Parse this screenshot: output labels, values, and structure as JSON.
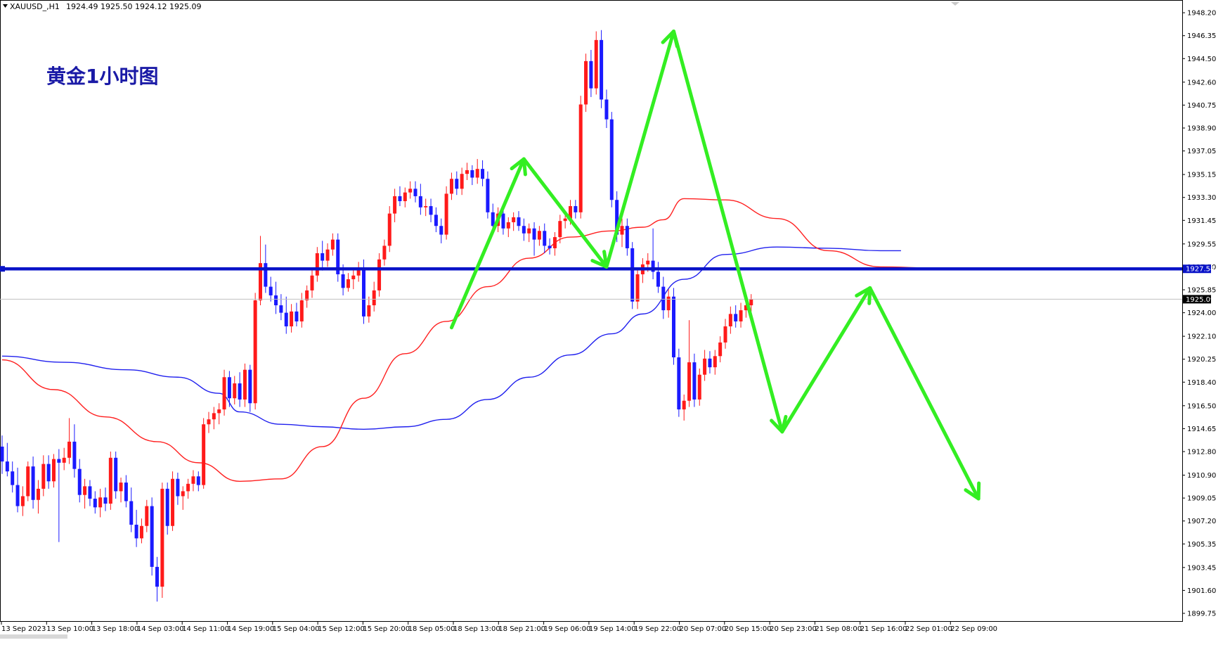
{
  "header": {
    "symbol": "XAUUSD_,H1",
    "ohlc": "1924.49 1925.50 1924.12 1925.09"
  },
  "title": "黄金1小时图",
  "colors": {
    "bull": "#ff1a1a",
    "bear": "#1a1aff",
    "ma_fast": "#ff2020",
    "ma_slow": "#2020ee",
    "level": "#0a14c8",
    "arrow": "#33ee22",
    "badge_level": "#0a14c8",
    "badge_price": "#000000"
  },
  "chart_data": {
    "type": "candlestick",
    "symbol": "XAUUSD_",
    "timeframe": "H1",
    "ylim": [
      1899.75,
      1949.0
    ],
    "y_ticks": [
      "1948.20",
      "1946.35",
      "1944.50",
      "1942.60",
      "1940.75",
      "1938.90",
      "1937.05",
      "1935.15",
      "1933.30",
      "1931.45",
      "1929.55",
      "1927.70",
      "1925.85",
      "1924.00",
      "1922.10",
      "1920.25",
      "1918.40",
      "1916.50",
      "1914.65",
      "1912.80",
      "1910.90",
      "1909.05",
      "1907.20",
      "1905.35",
      "1903.45",
      "1901.60",
      "1899.75"
    ],
    "x_labels": [
      "13 Sep 2023",
      "13 Sep 10:00",
      "13 Sep 18:00",
      "14 Sep 03:00",
      "14 Sep 11:00",
      "14 Sep 19:00",
      "15 Sep 04:00",
      "15 Sep 12:00",
      "15 Sep 20:00",
      "18 Sep 05:00",
      "18 Sep 13:00",
      "18 Sep 21:00",
      "19 Sep 06:00",
      "19 Sep 14:00",
      "19 Sep 22:00",
      "20 Sep 07:00",
      "20 Sep 15:00",
      "20 Sep 23:00",
      "21 Sep 08:00",
      "21 Sep 16:00",
      "22 Sep 01:00",
      "22 Sep 09:00"
    ],
    "level_line": {
      "value": 1927.54,
      "label": "1927.54"
    },
    "current_price": {
      "value": 1925.09,
      "label": "1925.09"
    },
    "candles": [
      [
        1913.2,
        1914.1,
        1911.0,
        1912.0
      ],
      [
        1912.0,
        1913.5,
        1910.8,
        1911.2
      ],
      [
        1911.2,
        1912.0,
        1909.5,
        1910.1
      ],
      [
        1910.1,
        1911.5,
        1907.9,
        1908.4
      ],
      [
        1908.4,
        1910.0,
        1907.6,
        1909.2
      ],
      [
        1909.2,
        1912.0,
        1908.8,
        1911.6
      ],
      [
        1911.6,
        1912.4,
        1908.2,
        1908.9
      ],
      [
        1908.9,
        1910.5,
        1907.8,
        1909.8
      ],
      [
        1909.8,
        1912.5,
        1909.2,
        1911.8
      ],
      [
        1911.8,
        1912.5,
        1909.8,
        1910.4
      ],
      [
        1910.4,
        1912.6,
        1909.9,
        1912.2
      ],
      [
        1912.2,
        1913.0,
        1905.5,
        1911.9
      ],
      [
        1911.9,
        1913.1,
        1911.3,
        1912.3
      ],
      [
        1912.3,
        1915.5,
        1911.8,
        1913.6
      ],
      [
        1913.6,
        1915.0,
        1910.7,
        1911.4
      ],
      [
        1911.4,
        1912.2,
        1908.7,
        1909.3
      ],
      [
        1909.3,
        1910.6,
        1908.2,
        1910.0
      ],
      [
        1910.0,
        1910.5,
        1908.4,
        1909.0
      ],
      [
        1909.0,
        1909.6,
        1907.8,
        1908.3
      ],
      [
        1908.3,
        1909.8,
        1907.5,
        1909.1
      ],
      [
        1909.1,
        1909.9,
        1908.0,
        1908.6
      ],
      [
        1908.6,
        1912.8,
        1908.1,
        1912.3
      ],
      [
        1912.3,
        1912.8,
        1909.0,
        1909.6
      ],
      [
        1909.6,
        1910.7,
        1908.7,
        1910.3
      ],
      [
        1910.3,
        1910.9,
        1908.3,
        1908.8
      ],
      [
        1908.8,
        1909.9,
        1906.3,
        1906.9
      ],
      [
        1906.9,
        1908.1,
        1905.1,
        1905.8
      ],
      [
        1905.8,
        1907.4,
        1905.4,
        1906.8
      ],
      [
        1906.8,
        1908.9,
        1906.3,
        1908.4
      ],
      [
        1908.4,
        1909.1,
        1902.8,
        1903.5
      ],
      [
        1903.5,
        1904.3,
        1900.7,
        1901.9
      ],
      [
        1901.9,
        1910.3,
        1901.0,
        1909.8
      ],
      [
        1909.8,
        1910.3,
        1906.1,
        1906.8
      ],
      [
        1906.8,
        1911.2,
        1906.4,
        1910.6
      ],
      [
        1910.6,
        1911.1,
        1908.5,
        1909.2
      ],
      [
        1909.2,
        1910.0,
        1908.1,
        1909.6
      ],
      [
        1909.6,
        1910.6,
        1909.0,
        1910.2
      ],
      [
        1910.2,
        1911.3,
        1909.6,
        1910.8
      ],
      [
        1910.8,
        1911.2,
        1909.6,
        1910.1
      ],
      [
        1910.1,
        1915.5,
        1909.8,
        1915.0
      ],
      [
        1915.0,
        1916.0,
        1914.3,
        1915.4
      ],
      [
        1915.4,
        1916.4,
        1914.6,
        1915.9
      ],
      [
        1915.9,
        1916.7,
        1915.0,
        1916.2
      ],
      [
        1916.2,
        1919.4,
        1915.7,
        1918.8
      ],
      [
        1918.8,
        1919.3,
        1916.4,
        1917.1
      ],
      [
        1917.1,
        1918.9,
        1916.6,
        1918.3
      ],
      [
        1918.3,
        1919.2,
        1916.4,
        1917.0
      ],
      [
        1917.0,
        1919.9,
        1916.4,
        1919.4
      ],
      [
        1919.4,
        1919.8,
        1916.0,
        1916.7
      ],
      [
        1916.7,
        1925.6,
        1916.2,
        1925.0
      ],
      [
        1925.0,
        1930.2,
        1924.6,
        1928.0
      ],
      [
        1928.0,
        1929.5,
        1925.6,
        1926.1
      ],
      [
        1926.1,
        1926.9,
        1924.9,
        1925.4
      ],
      [
        1925.4,
        1926.5,
        1923.9,
        1924.6
      ],
      [
        1924.6,
        1925.5,
        1923.4,
        1924.0
      ],
      [
        1924.0,
        1925.3,
        1922.3,
        1922.9
      ],
      [
        1922.9,
        1924.7,
        1922.4,
        1924.1
      ],
      [
        1924.1,
        1924.8,
        1922.9,
        1923.3
      ],
      [
        1923.3,
        1925.6,
        1922.8,
        1925.0
      ],
      [
        1925.0,
        1926.2,
        1924.4,
        1925.8
      ],
      [
        1925.8,
        1927.6,
        1925.2,
        1927.0
      ],
      [
        1927.0,
        1929.3,
        1926.5,
        1928.8
      ],
      [
        1928.8,
        1929.8,
        1927.4,
        1928.2
      ],
      [
        1928.2,
        1929.6,
        1927.7,
        1929.1
      ],
      [
        1929.1,
        1930.4,
        1928.6,
        1929.9
      ],
      [
        1929.9,
        1930.4,
        1926.5,
        1927.1
      ],
      [
        1927.1,
        1927.9,
        1925.4,
        1926.0
      ],
      [
        1926.0,
        1927.2,
        1925.7,
        1926.7
      ],
      [
        1926.7,
        1927.5,
        1925.9,
        1927.0
      ],
      [
        1927.0,
        1928.1,
        1926.5,
        1927.5
      ],
      [
        1927.5,
        1928.3,
        1923.1,
        1923.7
      ],
      [
        1923.7,
        1925.3,
        1923.2,
        1924.6
      ],
      [
        1924.6,
        1926.5,
        1924.1,
        1925.8
      ],
      [
        1925.8,
        1928.8,
        1925.3,
        1928.3
      ],
      [
        1928.3,
        1929.9,
        1927.8,
        1929.4
      ],
      [
        1929.4,
        1932.6,
        1928.9,
        1932.0
      ],
      [
        1932.0,
        1934.0,
        1931.3,
        1933.4
      ],
      [
        1933.4,
        1934.2,
        1932.6,
        1933.0
      ],
      [
        1933.0,
        1934.1,
        1932.5,
        1933.7
      ],
      [
        1933.7,
        1934.6,
        1933.2,
        1934.0
      ],
      [
        1934.0,
        1934.6,
        1932.9,
        1933.4
      ],
      [
        1933.4,
        1934.4,
        1931.9,
        1932.5
      ],
      [
        1932.5,
        1933.2,
        1931.8,
        1932.6
      ],
      [
        1932.6,
        1933.2,
        1931.3,
        1931.9
      ],
      [
        1931.9,
        1932.5,
        1930.5,
        1931.0
      ],
      [
        1931.0,
        1931.6,
        1929.6,
        1930.3
      ],
      [
        1930.3,
        1934.2,
        1929.9,
        1933.6
      ],
      [
        1933.6,
        1935.3,
        1933.1,
        1934.8
      ],
      [
        1934.8,
        1935.4,
        1933.5,
        1934.0
      ],
      [
        1934.0,
        1935.7,
        1933.5,
        1935.2
      ],
      [
        1935.2,
        1936.1,
        1934.7,
        1935.5
      ],
      [
        1935.5,
        1935.9,
        1934.3,
        1934.9
      ],
      [
        1934.9,
        1936.4,
        1934.4,
        1935.6
      ],
      [
        1935.6,
        1936.3,
        1934.2,
        1934.8
      ],
      [
        1934.8,
        1935.4,
        1931.6,
        1932.1
      ],
      [
        1932.1,
        1932.8,
        1930.4,
        1931.0
      ],
      [
        1931.0,
        1932.5,
        1930.5,
        1932.0
      ],
      [
        1932.0,
        1932.6,
        1930.3,
        1930.8
      ],
      [
        1930.8,
        1931.7,
        1930.1,
        1931.3
      ],
      [
        1931.3,
        1932.1,
        1930.6,
        1931.7
      ],
      [
        1931.7,
        1932.2,
        1930.6,
        1931.0
      ],
      [
        1931.0,
        1931.6,
        1929.8,
        1930.4
      ],
      [
        1930.4,
        1931.2,
        1929.7,
        1930.8
      ],
      [
        1930.8,
        1931.3,
        1928.6,
        1929.9
      ],
      [
        1929.9,
        1931.0,
        1929.4,
        1930.6
      ],
      [
        1930.6,
        1931.2,
        1928.8,
        1929.4
      ],
      [
        1929.4,
        1930.0,
        1928.7,
        1929.2
      ],
      [
        1929.2,
        1930.5,
        1928.6,
        1930.1
      ],
      [
        1930.1,
        1931.9,
        1929.6,
        1931.4
      ],
      [
        1931.4,
        1932.2,
        1930.8,
        1931.6
      ],
      [
        1931.6,
        1933.1,
        1931.1,
        1932.6
      ],
      [
        1932.6,
        1933.1,
        1931.6,
        1932.1
      ],
      [
        1932.1,
        1941.5,
        1931.6,
        1940.8
      ],
      [
        1940.8,
        1944.9,
        1940.2,
        1944.3
      ],
      [
        1944.3,
        1945.2,
        1941.4,
        1942.1
      ],
      [
        1942.1,
        1946.7,
        1941.6,
        1946.0
      ],
      [
        1946.0,
        1946.8,
        1940.5,
        1941.2
      ],
      [
        1941.2,
        1942.0,
        1938.9,
        1939.6
      ],
      [
        1939.6,
        1940.2,
        1932.5,
        1933.1
      ],
      [
        1933.1,
        1933.8,
        1929.7,
        1930.3
      ],
      [
        1930.3,
        1931.6,
        1929.3,
        1931.0
      ],
      [
        1931.0,
        1931.6,
        1928.6,
        1929.2
      ],
      [
        1929.2,
        1929.7,
        1924.3,
        1924.9
      ],
      [
        1924.9,
        1927.6,
        1924.3,
        1927.1
      ],
      [
        1927.1,
        1928.4,
        1926.4,
        1927.9
      ],
      [
        1927.9,
        1928.8,
        1927.3,
        1928.2
      ],
      [
        1928.2,
        1930.8,
        1926.7,
        1927.3
      ],
      [
        1927.3,
        1928.1,
        1925.6,
        1926.1
      ],
      [
        1926.1,
        1926.9,
        1923.5,
        1924.2
      ],
      [
        1924.2,
        1925.9,
        1923.6,
        1925.3
      ],
      [
        1925.3,
        1926.0,
        1919.8,
        1920.4
      ],
      [
        1920.4,
        1921.1,
        1915.6,
        1916.2
      ],
      [
        1916.2,
        1917.4,
        1915.3,
        1916.9
      ],
      [
        1916.9,
        1923.4,
        1916.4,
        1920.0
      ],
      [
        1920.0,
        1920.7,
        1916.4,
        1917.0
      ],
      [
        1917.0,
        1919.5,
        1916.5,
        1919.0
      ],
      [
        1919.0,
        1921.0,
        1918.5,
        1920.3
      ],
      [
        1920.3,
        1920.9,
        1919.1,
        1919.6
      ],
      [
        1919.6,
        1921.0,
        1919.0,
        1920.5
      ],
      [
        1920.5,
        1922.1,
        1920.0,
        1921.6
      ],
      [
        1921.6,
        1923.5,
        1921.1,
        1922.9
      ],
      [
        1922.9,
        1924.5,
        1922.3,
        1923.9
      ],
      [
        1923.9,
        1924.6,
        1922.8,
        1923.3
      ],
      [
        1923.3,
        1924.8,
        1922.8,
        1924.2
      ],
      [
        1924.2,
        1925.3,
        1923.6,
        1924.6
      ],
      [
        1924.6,
        1925.5,
        1924.1,
        1925.1
      ]
    ],
    "ma_fast": [
      1920.2,
      1917.8,
      1915.6,
      1913.6,
      1911.9,
      1910.4,
      1910.6,
      1913.2,
      1917.1,
      1920.7,
      1923.3,
      1926.1,
      1928.4,
      1930.1,
      1930.6,
      1930.9,
      1931.5,
      1933.2,
      1933.1,
      1931.6,
      1929.0,
      1927.7,
      1927.6
    ],
    "ma_fast_x": [
      0,
      10,
      20,
      30,
      38,
      46,
      54,
      62,
      70,
      78,
      86,
      94,
      102,
      110,
      118,
      124,
      128,
      132,
      140,
      150,
      160,
      170,
      181
    ],
    "ma_slow": [
      1920.5,
      1920.0,
      1919.4,
      1918.8,
      1917.5,
      1916.0,
      1915.0,
      1914.8,
      1914.6,
      1914.8,
      1915.4,
      1917.0,
      1918.8,
      1920.6,
      1922.3,
      1923.9,
      1926.7,
      1928.7,
      1929.3,
      1929.2,
      1929.0,
      1929.0
    ],
    "ma_slow_x": [
      0,
      12,
      24,
      34,
      42,
      46,
      54,
      62,
      70,
      78,
      86,
      94,
      102,
      110,
      118,
      124,
      132,
      140,
      150,
      160,
      170,
      174
    ],
    "arrows": [
      [
        [
          1922.8,
          87
        ],
        [
          1936.4,
          101
        ]
      ],
      [
        [
          1936.4,
          101
        ],
        [
          1927.7,
          117
        ]
      ],
      [
        [
          1927.7,
          117
        ],
        [
          1946.7,
          130
        ]
      ],
      [
        [
          1946.7,
          130
        ],
        [
          1914.4,
          151
        ]
      ],
      [
        [
          1914.4,
          151
        ],
        [
          1926.0,
          168
        ]
      ],
      [
        [
          1926.0,
          168
        ],
        [
          1909.0,
          189
        ]
      ]
    ]
  }
}
